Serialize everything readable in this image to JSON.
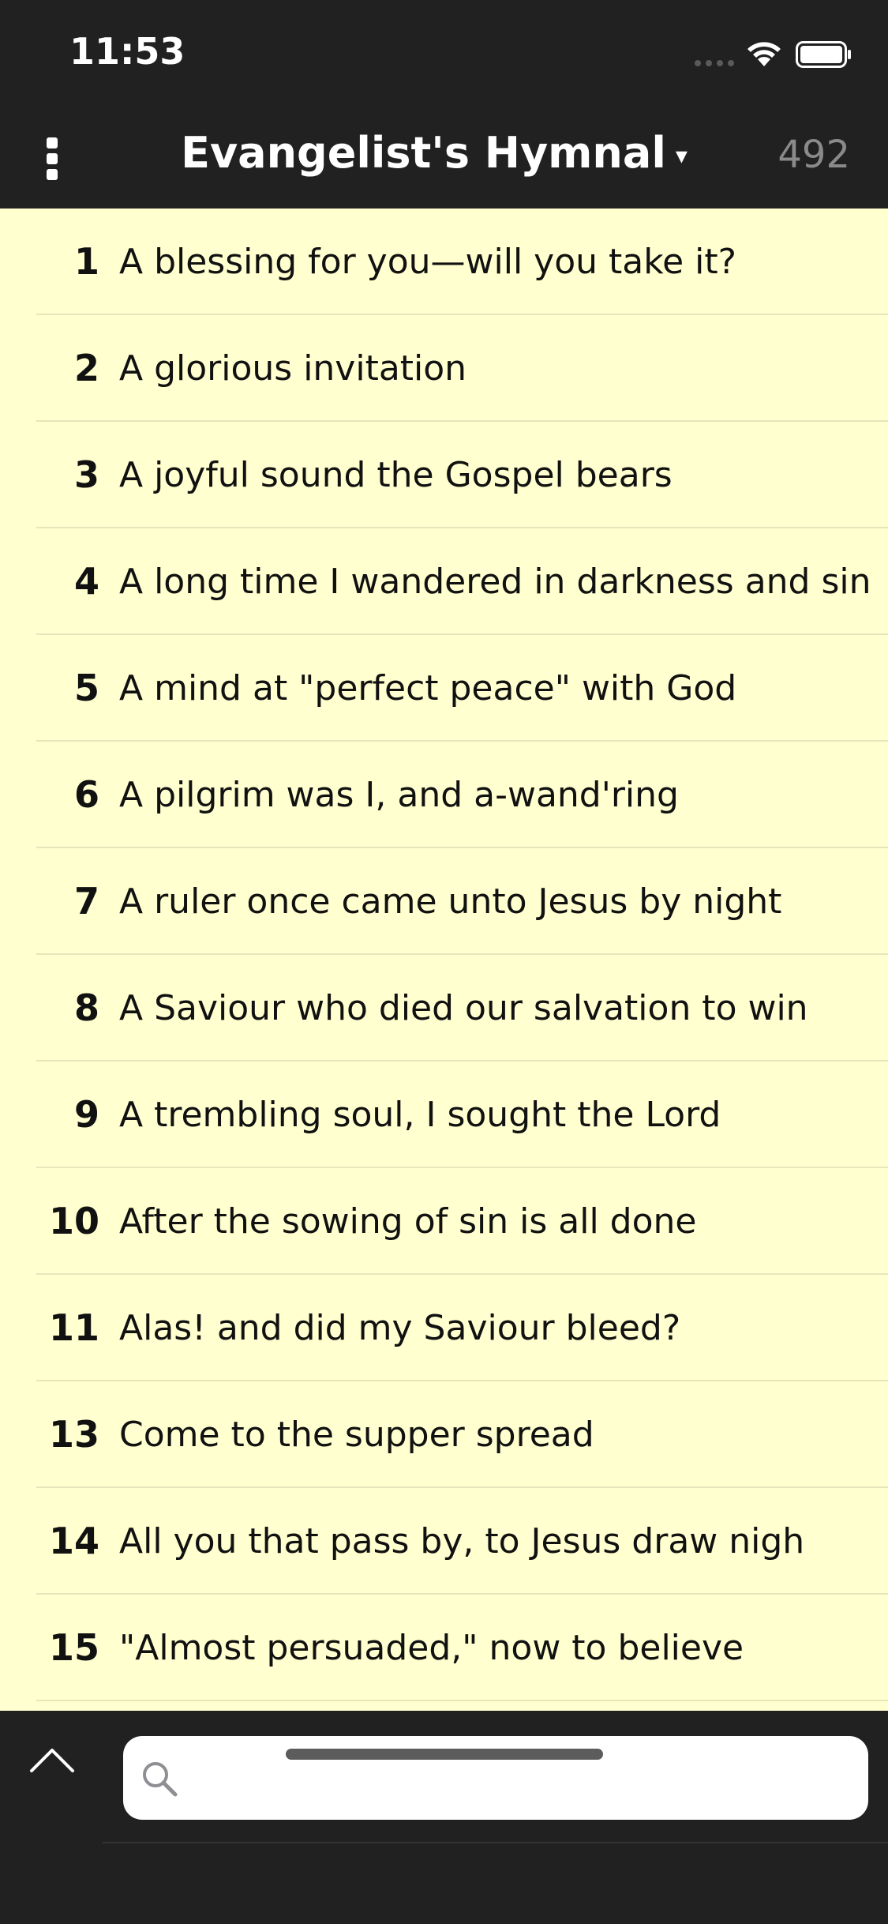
{
  "status_bar": {
    "time": "11:53"
  },
  "nav": {
    "title": "Evangelist's Hymnal",
    "caret": "▾",
    "count": "492"
  },
  "hymns": [
    {
      "number": "1",
      "title": "A blessing for you—will you take it?"
    },
    {
      "number": "2",
      "title": "A glorious invitation"
    },
    {
      "number": "3",
      "title": "A joyful sound the Gospel bears"
    },
    {
      "number": "4",
      "title": "A long time I wandered in darkness and sin"
    },
    {
      "number": "5",
      "title": "A mind at \"perfect peace\" with God"
    },
    {
      "number": "6",
      "title": "A pilgrim was I, and a-wand'ring"
    },
    {
      "number": "7",
      "title": "A ruler once came unto Jesus by night"
    },
    {
      "number": "8",
      "title": "A Saviour who died our salvation to win"
    },
    {
      "number": "9",
      "title": "A trembling soul, I sought the Lord"
    },
    {
      "number": "10",
      "title": "After the sowing of sin is all done"
    },
    {
      "number": "11",
      "title": "Alas! and did my Saviour bleed?"
    },
    {
      "number": "13",
      "title": "Come to the supper spread"
    },
    {
      "number": "14",
      "title": "All you that pass by, to Jesus draw nigh"
    },
    {
      "number": "15",
      "title": "\"Almost persuaded,\" now to believe"
    }
  ],
  "search": {
    "placeholder": "",
    "value": ""
  },
  "icons": {
    "menu": "more-vertical-icon",
    "up": "chevron-up-icon",
    "search": "search-icon",
    "wifi": "wifi-icon",
    "battery": "battery-icon",
    "signal": "signal-icon"
  },
  "colors": {
    "bar_background": "#212121",
    "list_background": "#ffffcf",
    "count_text": "#8a8a8a"
  }
}
